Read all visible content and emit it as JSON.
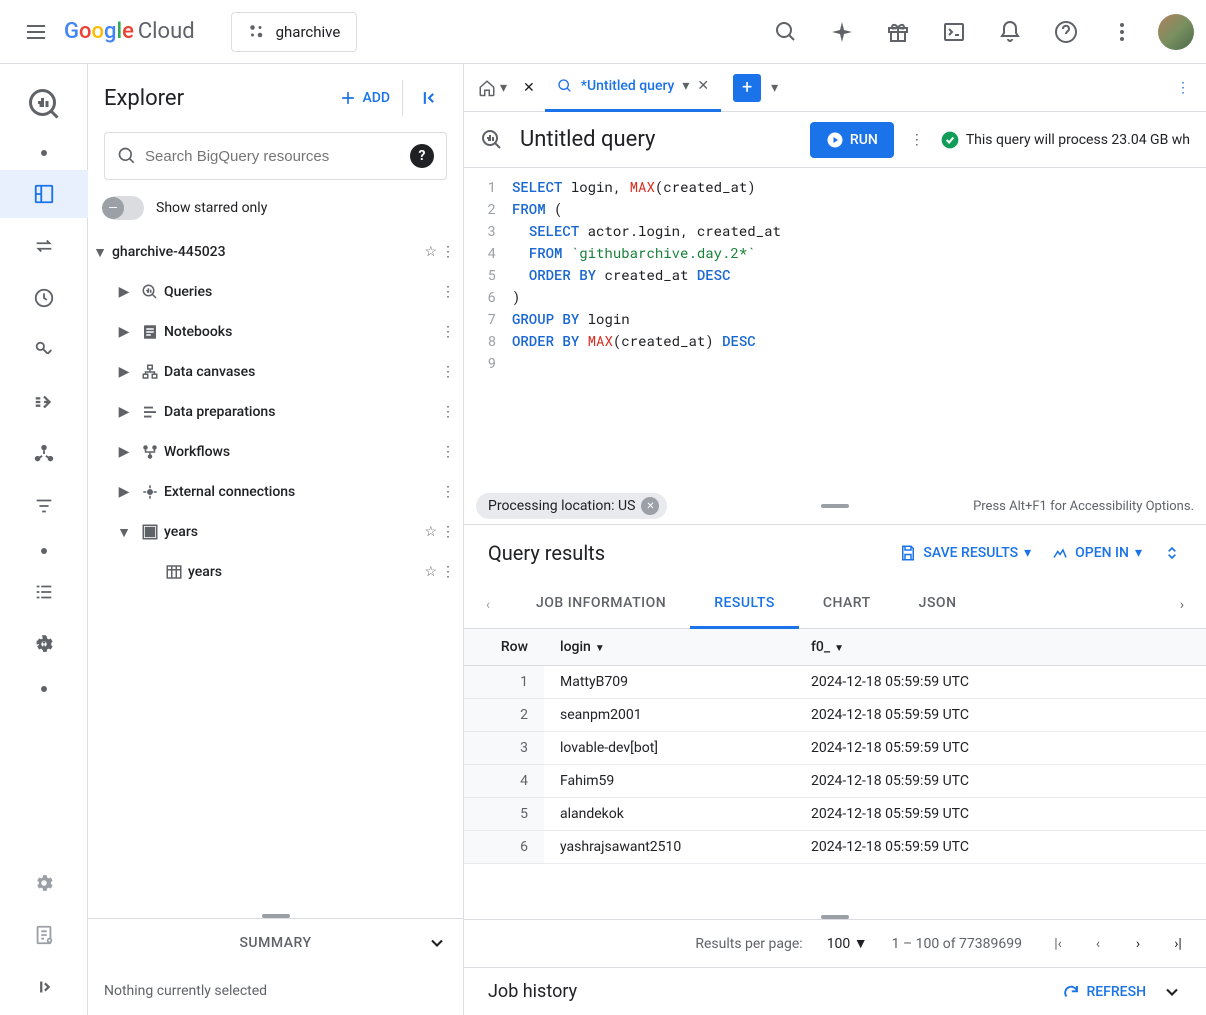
{
  "header": {
    "logo_cloud": "Cloud",
    "project_name": "gharchive"
  },
  "explorer": {
    "title": "Explorer",
    "add_label": "ADD",
    "search_placeholder": "Search BigQuery resources",
    "starred_label": "Show starred only",
    "project": {
      "name": "gharchive-445023",
      "items": [
        {
          "label": "Queries"
        },
        {
          "label": "Notebooks"
        },
        {
          "label": "Data canvases"
        },
        {
          "label": "Data preparations"
        },
        {
          "label": "Workflows"
        },
        {
          "label": "External connections"
        }
      ],
      "dataset": {
        "label": "years",
        "table": "years"
      }
    },
    "summary": {
      "title": "SUMMARY",
      "body": "Nothing currently selected"
    }
  },
  "tabs": {
    "home_dropdown": true,
    "active_tab": "*Untitled query"
  },
  "query": {
    "title": "Untitled query",
    "run_label": "RUN",
    "status_text": "This query will process 23.04 GB wh",
    "code_lines": 9
  },
  "status_bar": {
    "chip": "Processing location: US",
    "accessibility": "Press Alt+F1 for Accessibility Options."
  },
  "results": {
    "title": "Query results",
    "save_label": "SAVE RESULTS",
    "open_label": "OPEN IN",
    "tabs": [
      "JOB INFORMATION",
      "RESULTS",
      "CHART",
      "JSON"
    ],
    "active_tab": "RESULTS",
    "columns": [
      "Row",
      "login",
      "f0_"
    ],
    "rows": [
      {
        "row": "1",
        "login": "MattyB709",
        "f0": "2024-12-18 05:59:59 UTC"
      },
      {
        "row": "2",
        "login": "seanpm2001",
        "f0": "2024-12-18 05:59:59 UTC"
      },
      {
        "row": "3",
        "login": "lovable-dev[bot]",
        "f0": "2024-12-18 05:59:59 UTC"
      },
      {
        "row": "4",
        "login": "Fahim59",
        "f0": "2024-12-18 05:59:59 UTC"
      },
      {
        "row": "5",
        "login": "alandekok",
        "f0": "2024-12-18 05:59:59 UTC"
      },
      {
        "row": "6",
        "login": "yashrajsawant2510",
        "f0": "2024-12-18 05:59:59 UTC"
      }
    ],
    "pagination": {
      "per_page_label": "Results per page:",
      "per_page_value": "100",
      "range": "1 – 100 of 77389699"
    }
  },
  "job_history": {
    "title": "Job history",
    "refresh_label": "REFRESH"
  }
}
